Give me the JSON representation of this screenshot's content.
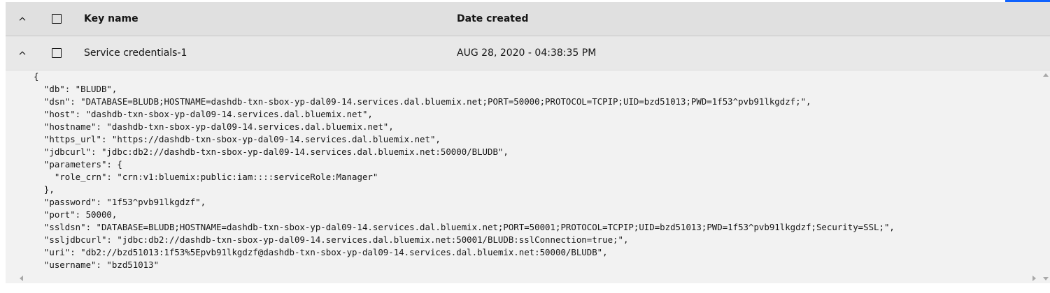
{
  "header": {
    "key_name_label": "Key name",
    "date_created_label": "Date created"
  },
  "rows": [
    {
      "key_name": "Service credentials-1",
      "date_created": "AUG 28, 2020 - 04:38:35 PM",
      "expanded": true,
      "credentials_json": "{\n  \"db\": \"BLUDB\",\n  \"dsn\": \"DATABASE=BLUDB;HOSTNAME=dashdb-txn-sbox-yp-dal09-14.services.dal.bluemix.net;PORT=50000;PROTOCOL=TCPIP;UID=bzd51013;PWD=1f53^pvb91lkgdzf;\",\n  \"host\": \"dashdb-txn-sbox-yp-dal09-14.services.dal.bluemix.net\",\n  \"hostname\": \"dashdb-txn-sbox-yp-dal09-14.services.dal.bluemix.net\",\n  \"https_url\": \"https://dashdb-txn-sbox-yp-dal09-14.services.dal.bluemix.net\",\n  \"jdbcurl\": \"jdbc:db2://dashdb-txn-sbox-yp-dal09-14.services.dal.bluemix.net:50000/BLUDB\",\n  \"parameters\": {\n    \"role_crn\": \"crn:v1:bluemix:public:iam::::serviceRole:Manager\"\n  },\n  \"password\": \"1f53^pvb91lkgdzf\",\n  \"port\": 50000,\n  \"ssldsn\": \"DATABASE=BLUDB;HOSTNAME=dashdb-txn-sbox-yp-dal09-14.services.dal.bluemix.net;PORT=50001;PROTOCOL=TCPIP;UID=bzd51013;PWD=1f53^pvb91lkgdzf;Security=SSL;\",\n  \"ssljdbcurl\": \"jdbc:db2://dashdb-txn-sbox-yp-dal09-14.services.dal.bluemix.net:50001/BLUDB:sslConnection=true;\",\n  \"uri\": \"db2://bzd51013:1f53%5Epvb91lkgdzf@dashdb-txn-sbox-yp-dal09-14.services.dal.bluemix.net:50000/BLUDB\",\n  \"username\": \"bzd51013\"\n}"
    }
  ],
  "icons": {
    "collapse_all": "chevron-up-icon",
    "collapse_row": "chevron-up-icon",
    "scroll_up": "triangle-up-icon",
    "scroll_down": "triangle-down-icon",
    "scroll_left": "triangle-left-icon",
    "scroll_right": "triangle-right-icon"
  },
  "colors": {
    "accent": "#0f62fe",
    "header_bg": "#e0e0e0",
    "row_bg": "#e8e8e8",
    "panel_bg": "#f2f2f2",
    "text": "#161616"
  }
}
